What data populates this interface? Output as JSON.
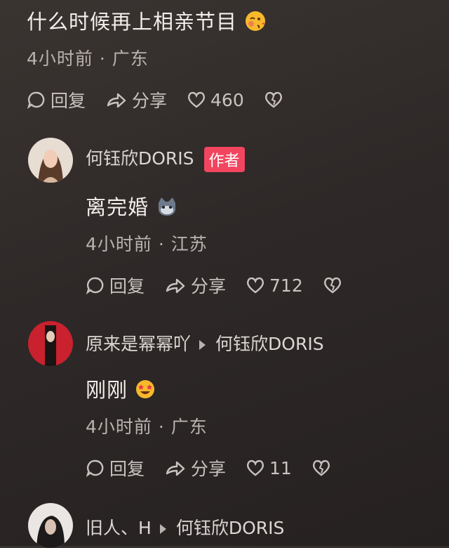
{
  "comment1": {
    "text": "什么时候再上相亲节目",
    "emoji": "blushing-kiss-emoji",
    "time": "4小时前",
    "location": "广东",
    "reply": "回复",
    "share": "分享",
    "likes": "460"
  },
  "reply1": {
    "author": "何钰欣DORIS",
    "badge": "作者",
    "text": "离完婚",
    "emoji": "cat-emoji",
    "time": "4小时前",
    "location": "江苏",
    "reply": "回复",
    "share": "分享",
    "likes": "712"
  },
  "reply2": {
    "author": "原来是幂幂吖",
    "reply_to": "何钰欣DORIS",
    "text": "刚刚",
    "emoji": "star-struck-emoji",
    "time": "4小时前",
    "location": "广东",
    "reply": "回复",
    "share": "分享",
    "likes": "11"
  },
  "reply3": {
    "author": "旧人、H",
    "reply_to": "何钰欣DORIS"
  },
  "separator": "·",
  "colors": {
    "badge": "#f2455f",
    "background": "#2e2928"
  }
}
